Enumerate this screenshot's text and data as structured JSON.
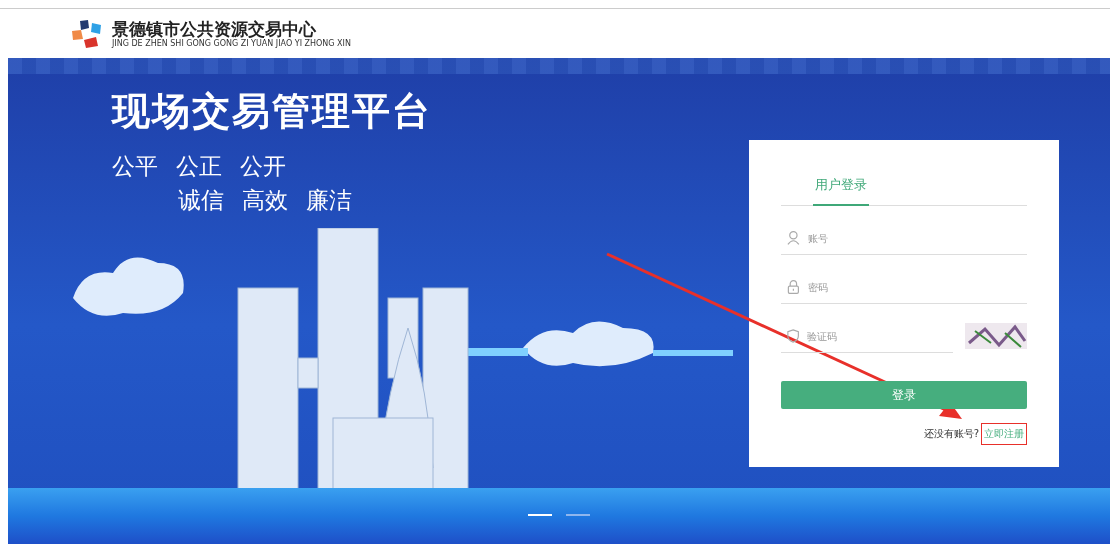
{
  "header": {
    "logo_title": "景德镇市公共资源交易中心",
    "logo_subtitle": "JING DE ZHEN SHI GONG GONG ZI YUAN JIAO YI ZHONG XIN"
  },
  "banner": {
    "title": "现场交易管理平台",
    "slogan_rows": [
      [
        "公平",
        "公正",
        "公开"
      ],
      [
        "诚信",
        "高效",
        "廉洁"
      ]
    ]
  },
  "carousel": [
    {
      "selected": true
    },
    {
      "selected": false
    }
  ],
  "login": {
    "tabs": [
      {
        "label": "用户登录",
        "selected": true
      }
    ],
    "fields": [
      {
        "kind": "account",
        "placeholder": "账号"
      },
      {
        "kind": "password",
        "placeholder": "密码"
      },
      {
        "kind": "captcha",
        "placeholder": "验证码"
      }
    ],
    "submit": "登录",
    "register_prompt": "还没有账号?",
    "register_link": "立即注册"
  }
}
